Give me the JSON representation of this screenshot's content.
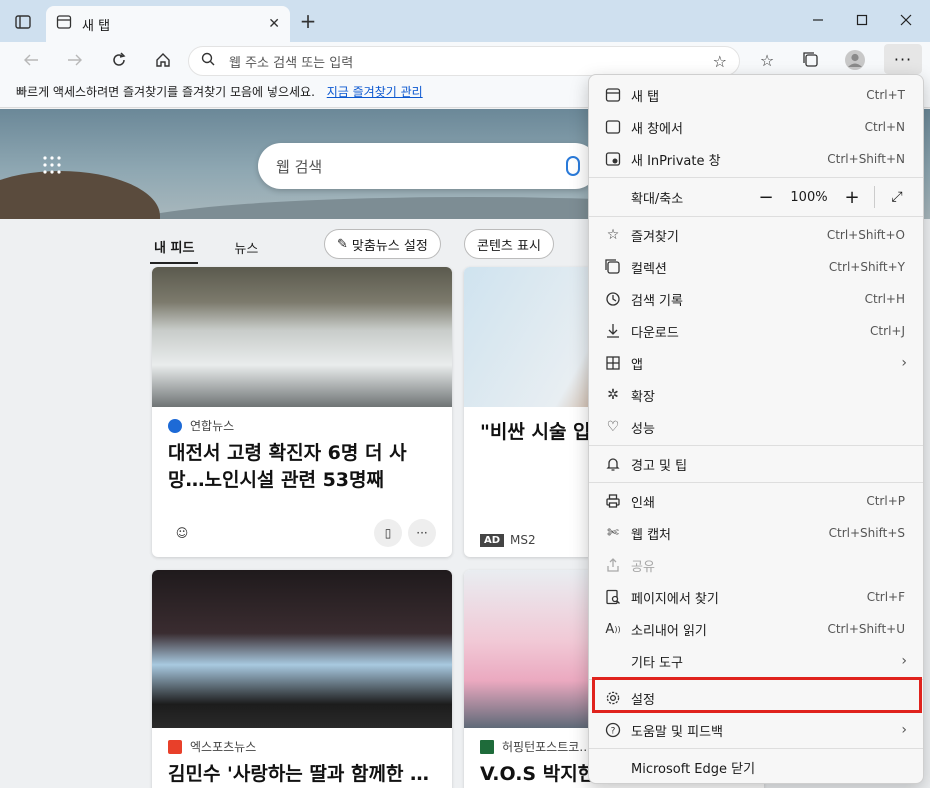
{
  "browser": {
    "tab_title": "새 탭",
    "address_placeholder": "웹 주소 검색 또는 입력"
  },
  "favorites_bar": {
    "message": "빠르게 액세스하려면 즐겨찾기를 즐겨찾기 모음에 넣으세요.",
    "link": "지금 즐겨찾기 관리"
  },
  "page": {
    "search_placeholder": "웹 검색",
    "feed_tabs": [
      "내 피드",
      "뉴스"
    ],
    "personalize_button": "맞춤뉴스 설정",
    "content_button": "콘텐츠 표시",
    "cards": [
      {
        "source": "연합뉴스",
        "headline": "대전서 고령 확진자 6명 더 사망…노인시설 관련 53명째"
      },
      {
        "source": "MS2",
        "headline": "\"비싼 시술 입… 져? 5060 여…",
        "ad": "AD"
      },
      {
        "source": "엑스포츠뉴스",
        "headline": "김민수 '사랑하는 딸과 함께한 …"
      },
      {
        "source": "허핑턴포스트코…",
        "headline": "V.O.S 박지헌 …"
      }
    ]
  },
  "menu": {
    "items": [
      {
        "label": "새 탭",
        "shortcut": "Ctrl+T",
        "icon": "new-tab-icon"
      },
      {
        "label": "새 창에서",
        "shortcut": "Ctrl+N",
        "icon": "new-window-icon"
      },
      {
        "label": "새 InPrivate 창",
        "shortcut": "Ctrl+Shift+N",
        "icon": "inprivate-icon"
      },
      {
        "label": "확대/축소",
        "zoom": "100%"
      },
      {
        "label": "즐겨찾기",
        "shortcut": "Ctrl+Shift+O",
        "icon": "favorites-icon"
      },
      {
        "label": "컬렉션",
        "shortcut": "Ctrl+Shift+Y",
        "icon": "collections-icon"
      },
      {
        "label": "검색 기록",
        "shortcut": "Ctrl+H",
        "icon": "history-icon"
      },
      {
        "label": "다운로드",
        "shortcut": "Ctrl+J",
        "icon": "download-icon"
      },
      {
        "label": "앱",
        "icon": "apps-icon"
      },
      {
        "label": "확장",
        "icon": "extensions-icon"
      },
      {
        "label": "성능",
        "icon": "performance-icon"
      },
      {
        "label": "경고 및 팁",
        "icon": "bell-icon"
      },
      {
        "label": "인쇄",
        "shortcut": "Ctrl+P",
        "icon": "print-icon"
      },
      {
        "label": "웹 캡처",
        "shortcut": "Ctrl+Shift+S",
        "icon": "web-capture-icon"
      },
      {
        "label": "공유",
        "icon": "share-icon"
      },
      {
        "label": "페이지에서 찾기",
        "shortcut": "Ctrl+F",
        "icon": "find-icon"
      },
      {
        "label": "소리내어 읽기",
        "shortcut": "Ctrl+Shift+U",
        "icon": "read-aloud-icon"
      },
      {
        "label": "기타 도구"
      },
      {
        "label": "설정",
        "icon": "settings-icon"
      },
      {
        "label": "도움말 및 피드백",
        "icon": "help-icon"
      },
      {
        "label": "Microsoft Edge 닫기"
      }
    ]
  },
  "colors": {
    "highlight": "#e0231d",
    "link": "#0b57d0"
  }
}
